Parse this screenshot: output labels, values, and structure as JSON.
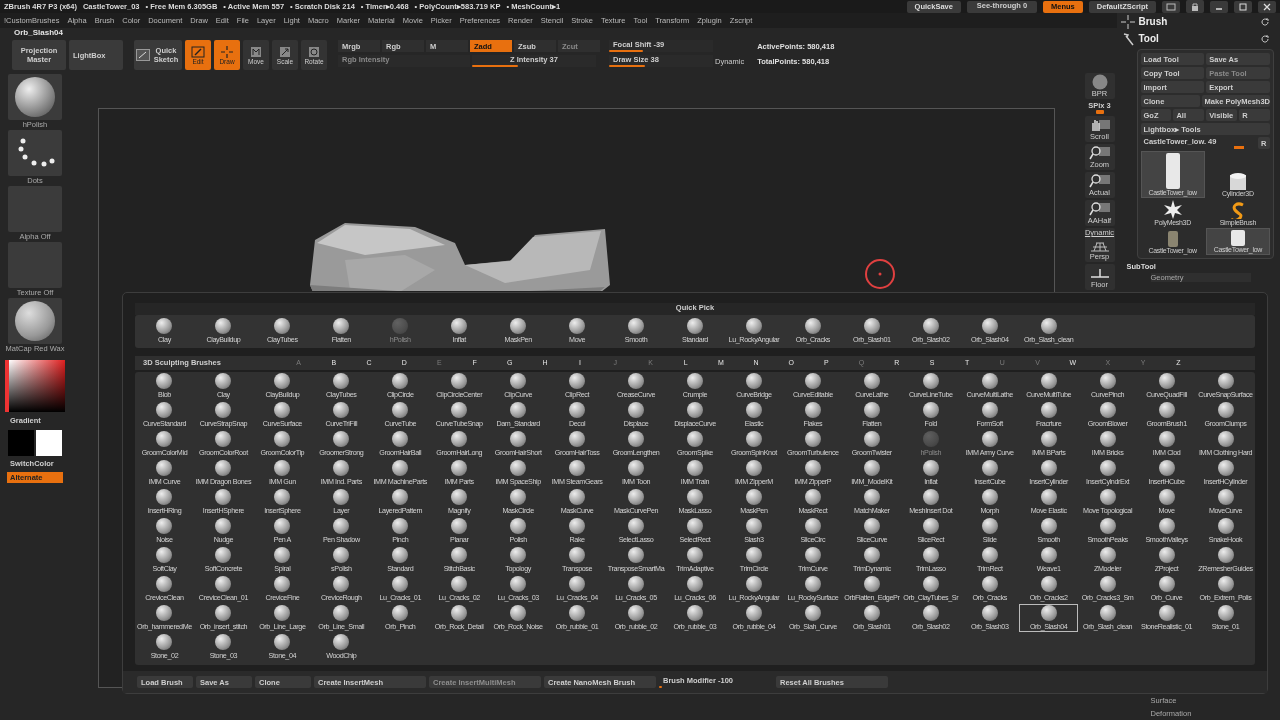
{
  "title_bar": {
    "app": "ZBrush 4R7 P3 (x64)",
    "document": "CastleTower_03",
    "stats": [
      "• Free Mem 6.305GB",
      "• Active Mem 557",
      "• Scratch Disk 214",
      "• Timer▸0.468",
      "• PolyCount▸583.719 KP",
      "• MeshCount▸1"
    ],
    "quicksave": "QuickSave",
    "see_through": {
      "label": "See-through",
      "value": "0",
      "level": 0
    },
    "menus": {
      "label": "Menus",
      "on": true
    },
    "script": "DefaultZScript"
  },
  "menu_bar": [
    "!CustomBrushes",
    "Alpha",
    "Brush",
    "Color",
    "Document",
    "Draw",
    "Edit",
    "File",
    "Layer",
    "Light",
    "Macro",
    "Marker",
    "Material",
    "Movie",
    "Picker",
    "Preferences",
    "Render",
    "Stencil",
    "Stroke",
    "Texture",
    "Tool",
    "Transform",
    "Zplugin",
    "Zscript"
  ],
  "current_brush": "Orb_Slash04",
  "toolbar": {
    "projection_master": "Projection Master",
    "lightbox": "LightBox",
    "quick_sketch": "Quick Sketch",
    "modes": [
      {
        "label": "Edit",
        "kind": "edit",
        "on": true
      },
      {
        "label": "Draw",
        "kind": "draw",
        "on": true
      },
      {
        "label": "Move",
        "kind": "move",
        "on": false
      },
      {
        "label": "Scale",
        "kind": "scale",
        "on": false
      },
      {
        "label": "Rotate",
        "kind": "rotate",
        "on": false
      }
    ],
    "color_modes": [
      {
        "label": "Mrgb",
        "on": false
      },
      {
        "label": "Rgb",
        "on": false
      },
      {
        "label": "M",
        "on": false
      }
    ],
    "rgb_intensity": {
      "label": "Rgb Intensity",
      "disabled": true
    },
    "z_modes": [
      {
        "label": "Zadd",
        "on": true,
        "disabled": false
      },
      {
        "label": "Zsub",
        "on": false,
        "disabled": false
      },
      {
        "label": "Zcut",
        "on": false,
        "disabled": true
      }
    ],
    "z_intensity": {
      "label": "Z Intensity",
      "value": "37",
      "level": 0.37
    },
    "focal_shift": {
      "label": "Focal Shift",
      "value": "-39",
      "level": 0.33
    },
    "draw_size": {
      "label": "Draw Size",
      "value": "38",
      "level": 0.35
    },
    "dynamic": "Dynamic",
    "active_points": "ActivePoints: 580,418",
    "total_points": "TotalPoints: 580,418"
  },
  "shelf": [
    {
      "label": "hPolish",
      "kind": "brush"
    },
    {
      "label": "Dots",
      "kind": "stroke"
    },
    {
      "label": "Alpha Off",
      "kind": "alpha"
    },
    {
      "label": "Texture Off",
      "kind": "texture"
    },
    {
      "label": "MatCap Red Wax",
      "kind": "material"
    }
  ],
  "gradient": "Gradient",
  "switch_color": "SwitchColor",
  "alternate": {
    "label": "Alternate",
    "on": true
  },
  "dock": [
    {
      "label": "BPR",
      "kind": "bpr"
    },
    {
      "label": "SPix 3",
      "kind": "slider",
      "level": 0.5
    },
    {
      "label": "Scroll",
      "kind": "scroll"
    },
    {
      "label": "Zoom",
      "kind": "zoom"
    },
    {
      "label": "Actual",
      "kind": "zoom"
    },
    {
      "label": "AAHalf",
      "kind": "zoom"
    },
    {
      "label": "Persp",
      "kind": "persp",
      "top": "Dynamic"
    },
    {
      "label": "Floor",
      "kind": "floor"
    }
  ],
  "right_panel": {
    "brush": "Brush",
    "tool": "Tool",
    "tool_buttons": [
      [
        {
          "label": "Load Tool",
          "disabled": false
        },
        {
          "label": "Save As",
          "disabled": false
        }
      ],
      [
        {
          "label": "Copy Tool",
          "disabled": false
        },
        {
          "label": "Paste Tool",
          "disabled": true
        }
      ],
      [
        {
          "label": "Import",
          "disabled": false
        },
        {
          "label": "Export",
          "disabled": false
        }
      ],
      [
        {
          "label": "Clone",
          "disabled": false
        },
        {
          "label": "Make PolyMesh3D",
          "disabled": false
        }
      ],
      [
        {
          "label": "GoZ",
          "disabled": false
        },
        {
          "label": "All",
          "disabled": false
        },
        {
          "label": "Visible",
          "disabled": false
        },
        {
          "label": "R",
          "disabled": false
        }
      ],
      [
        {
          "label": "Lightbox▸ Tools",
          "disabled": false
        }
      ]
    ],
    "tool_slider": {
      "label": "CastleTower_low. 49",
      "level": 0.9
    },
    "reset": "R",
    "tools": [
      {
        "label": "CastleTower_low",
        "kind": "tower",
        "selected": true
      },
      {
        "label": "Cylinder3D",
        "kind": "cylinder",
        "selected": false
      },
      {
        "label": "PolyMesh3D",
        "kind": "star",
        "selected": false
      },
      {
        "label": "SimpleBrush",
        "kind": "simple",
        "selected": false
      },
      {
        "label": "CastleTower_low",
        "kind": "tower-small",
        "selected": false
      },
      {
        "label": "CastleTower_low",
        "kind": "tower",
        "selected": true
      }
    ],
    "subtool": "SubTool",
    "geometry": "Geometry",
    "lower": [
      "Surface",
      "Deformation"
    ]
  },
  "brush_palette": {
    "quick_pick": {
      "title": "Quick Pick",
      "items": [
        {
          "name": "Clay",
          "disabled": false
        },
        {
          "name": "ClayBuildup",
          "disabled": false
        },
        {
          "name": "ClayTubes",
          "disabled": false
        },
        {
          "name": "Flatten",
          "disabled": false
        },
        {
          "name": "hPolish",
          "disabled": true
        },
        {
          "name": "Inflat",
          "disabled": false
        },
        {
          "name": "MaskPen",
          "disabled": false
        },
        {
          "name": "Move",
          "disabled": false
        },
        {
          "name": "Smooth",
          "disabled": false
        },
        {
          "name": "Standard",
          "disabled": false
        },
        {
          "name": "Lu_RockyAngular",
          "disabled": false
        },
        {
          "name": "Orb_Cracks",
          "disabled": false
        },
        {
          "name": "Orb_Slash01",
          "disabled": false
        },
        {
          "name": "Orb_Slash02",
          "disabled": false
        },
        {
          "name": "Orb_Slash04",
          "disabled": false
        },
        {
          "name": "Orb_Slash_clean",
          "disabled": false
        }
      ]
    },
    "title": "3D Sculpting Brushes",
    "letters": [
      {
        "letter": "A",
        "active": false
      },
      {
        "letter": "B",
        "active": true
      },
      {
        "letter": "C",
        "active": true
      },
      {
        "letter": "D",
        "active": true
      },
      {
        "letter": "E",
        "active": false
      },
      {
        "letter": "F",
        "active": true
      },
      {
        "letter": "G",
        "active": true
      },
      {
        "letter": "H",
        "active": true
      },
      {
        "letter": "I",
        "active": true
      },
      {
        "letter": "J",
        "active": false
      },
      {
        "letter": "K",
        "active": false
      },
      {
        "letter": "L",
        "active": true
      },
      {
        "letter": "M",
        "active": true
      },
      {
        "letter": "N",
        "active": true
      },
      {
        "letter": "O",
        "active": true
      },
      {
        "letter": "P",
        "active": true
      },
      {
        "letter": "Q",
        "active": false
      },
      {
        "letter": "R",
        "active": true
      },
      {
        "letter": "S",
        "active": true
      },
      {
        "letter": "T",
        "active": true
      },
      {
        "letter": "U",
        "active": false
      },
      {
        "letter": "V",
        "active": false
      },
      {
        "letter": "W",
        "active": true
      },
      {
        "letter": "X",
        "active": false
      },
      {
        "letter": "Y",
        "active": false
      },
      {
        "letter": "Z",
        "active": true
      }
    ],
    "items": [
      {
        "name": "Blob",
        "selected": false,
        "disabled": false
      },
      {
        "name": "Clay",
        "selected": false,
        "disabled": false
      },
      {
        "name": "ClayBuildup",
        "selected": false,
        "disabled": false
      },
      {
        "name": "ClayTubes",
        "selected": false,
        "disabled": false
      },
      {
        "name": "ClipCircle",
        "selected": false,
        "disabled": false
      },
      {
        "name": "ClipCircleCenter",
        "selected": false,
        "disabled": false
      },
      {
        "name": "ClipCurve",
        "selected": false,
        "disabled": false
      },
      {
        "name": "ClipRect",
        "selected": false,
        "disabled": false
      },
      {
        "name": "CreaseCurve",
        "selected": false,
        "disabled": false
      },
      {
        "name": "Crumple",
        "selected": false,
        "disabled": false
      },
      {
        "name": "CurveBridge",
        "selected": false,
        "disabled": false
      },
      {
        "name": "CurveEditable",
        "selected": false,
        "disabled": false
      },
      {
        "name": "CurveLathe",
        "selected": false,
        "disabled": false
      },
      {
        "name": "CurveLineTube",
        "selected": false,
        "disabled": false
      },
      {
        "name": "CurveMultiLathe",
        "selected": false,
        "disabled": false
      },
      {
        "name": "CurveMultiTube",
        "selected": false,
        "disabled": false
      },
      {
        "name": "CurvePinch",
        "selected": false,
        "disabled": false
      },
      {
        "name": "CurveQuadFill",
        "selected": false,
        "disabled": false
      },
      {
        "name": "CurveSnapSurface",
        "selected": false,
        "disabled": false
      },
      {
        "name": "CurveStandard",
        "selected": false,
        "disabled": false
      },
      {
        "name": "CurveStrapSnap",
        "selected": false,
        "disabled": false
      },
      {
        "name": "CurveSurface",
        "selected": false,
        "disabled": false
      },
      {
        "name": "CurveTriFill",
        "selected": false,
        "disabled": false
      },
      {
        "name": "CurveTube",
        "selected": false,
        "disabled": false
      },
      {
        "name": "CurveTubeSnap",
        "selected": false,
        "disabled": false
      },
      {
        "name": "Dam_Standard",
        "selected": false,
        "disabled": false
      },
      {
        "name": "Decol",
        "selected": false,
        "disabled": false
      },
      {
        "name": "Displace",
        "selected": false,
        "disabled": false
      },
      {
        "name": "DisplaceCurve",
        "selected": false,
        "disabled": false
      },
      {
        "name": "Elastic",
        "selected": false,
        "disabled": false
      },
      {
        "name": "Flakes",
        "selected": false,
        "disabled": false
      },
      {
        "name": "Flatten",
        "selected": false,
        "disabled": false
      },
      {
        "name": "Fold",
        "selected": false,
        "disabled": false
      },
      {
        "name": "FormSoft",
        "selected": false,
        "disabled": false
      },
      {
        "name": "Fracrture",
        "selected": false,
        "disabled": false
      },
      {
        "name": "GroomBlower",
        "selected": false,
        "disabled": false
      },
      {
        "name": "GroomBrush1",
        "selected": false,
        "disabled": false
      },
      {
        "name": "GroomClumps",
        "selected": false,
        "disabled": false
      },
      {
        "name": "GroomColorMid",
        "selected": false,
        "disabled": false
      },
      {
        "name": "GroomColorRoot",
        "selected": false,
        "disabled": false
      },
      {
        "name": "GroomColorTip",
        "selected": false,
        "disabled": false
      },
      {
        "name": "GroomerStrong",
        "selected": false,
        "disabled": false
      },
      {
        "name": "GroomHairBall",
        "selected": false,
        "disabled": false
      },
      {
        "name": "GroomHairLong",
        "selected": false,
        "disabled": false
      },
      {
        "name": "GroomHairShort",
        "selected": false,
        "disabled": false
      },
      {
        "name": "GroomHairToss",
        "selected": false,
        "disabled": false
      },
      {
        "name": "GroomLengthen",
        "selected": false,
        "disabled": false
      },
      {
        "name": "GroomSpike",
        "selected": false,
        "disabled": false
      },
      {
        "name": "GroomSpinKnot",
        "selected": false,
        "disabled": false
      },
      {
        "name": "GroomTurbulence",
        "selected": false,
        "disabled": false
      },
      {
        "name": "GroomTwister",
        "selected": false,
        "disabled": false
      },
      {
        "name": "hPolish",
        "selected": false,
        "disabled": true
      },
      {
        "name": "IMM Army Curve",
        "selected": false,
        "disabled": false
      },
      {
        "name": "IMM BParts",
        "selected": false,
        "disabled": false
      },
      {
        "name": "IMM Bricks",
        "selected": false,
        "disabled": false
      },
      {
        "name": "IMM Clod",
        "selected": false,
        "disabled": false
      },
      {
        "name": "IMM Clothing Hard",
        "selected": false,
        "disabled": false
      },
      {
        "name": "IMM Curve",
        "selected": false,
        "disabled": false
      },
      {
        "name": "IMM Dragon Bones",
        "selected": false,
        "disabled": false
      },
      {
        "name": "IMM Gun",
        "selected": false,
        "disabled": false
      },
      {
        "name": "IMM Ind. Parts",
        "selected": false,
        "disabled": false
      },
      {
        "name": "IMM MachineParts",
        "selected": false,
        "disabled": false
      },
      {
        "name": "IMM Parts",
        "selected": false,
        "disabled": false
      },
      {
        "name": "IMM SpaceShip",
        "selected": false,
        "disabled": false
      },
      {
        "name": "IMM SteamGears",
        "selected": false,
        "disabled": false
      },
      {
        "name": "IMM Toon",
        "selected": false,
        "disabled": false
      },
      {
        "name": "IMM Train",
        "selected": false,
        "disabled": false
      },
      {
        "name": "IMM ZipperM",
        "selected": false,
        "disabled": false
      },
      {
        "name": "IMM ZipperP",
        "selected": false,
        "disabled": false
      },
      {
        "name": "IMM_ModelKit",
        "selected": false,
        "disabled": false
      },
      {
        "name": "Inflat",
        "selected": false,
        "disabled": false
      },
      {
        "name": "InsertCube",
        "selected": false,
        "disabled": false
      },
      {
        "name": "InsertCylinder",
        "selected": false,
        "disabled": false
      },
      {
        "name": "InsertCylndrExt",
        "selected": false,
        "disabled": false
      },
      {
        "name": "InsertHCube",
        "selected": false,
        "disabled": false
      },
      {
        "name": "InsertHCylinder",
        "selected": false,
        "disabled": false
      },
      {
        "name": "InsertHRing",
        "selected": false,
        "disabled": false
      },
      {
        "name": "InsertHSphere",
        "selected": false,
        "disabled": false
      },
      {
        "name": "InsertSphere",
        "selected": false,
        "disabled": false
      },
      {
        "name": "Layer",
        "selected": false,
        "disabled": false
      },
      {
        "name": "LayeredPattern",
        "selected": false,
        "disabled": false
      },
      {
        "name": "Magnify",
        "selected": false,
        "disabled": false
      },
      {
        "name": "MaskCircle",
        "selected": false,
        "disabled": false
      },
      {
        "name": "MaskCurve",
        "selected": false,
        "disabled": false
      },
      {
        "name": "MaskCurvePen",
        "selected": false,
        "disabled": false
      },
      {
        "name": "MaskLasso",
        "selected": false,
        "disabled": false
      },
      {
        "name": "MaskPen",
        "selected": false,
        "disabled": false
      },
      {
        "name": "MaskRect",
        "selected": false,
        "disabled": false
      },
      {
        "name": "MatchMaker",
        "selected": false,
        "disabled": false
      },
      {
        "name": "MeshInsert Dot",
        "selected": false,
        "disabled": false
      },
      {
        "name": "Morph",
        "selected": false,
        "disabled": false
      },
      {
        "name": "Move Elastic",
        "selected": false,
        "disabled": false
      },
      {
        "name": "Move Topological",
        "selected": false,
        "disabled": false
      },
      {
        "name": "Move",
        "selected": false,
        "disabled": false
      },
      {
        "name": "MoveCurve",
        "selected": false,
        "disabled": false
      },
      {
        "name": "Noise",
        "selected": false,
        "disabled": false
      },
      {
        "name": "Nudge",
        "selected": false,
        "disabled": false
      },
      {
        "name": "Pen A",
        "selected": false,
        "disabled": false
      },
      {
        "name": "Pen Shadow",
        "selected": false,
        "disabled": false
      },
      {
        "name": "Pinch",
        "selected": false,
        "disabled": false
      },
      {
        "name": "Planar",
        "selected": false,
        "disabled": false
      },
      {
        "name": "Polish",
        "selected": false,
        "disabled": false
      },
      {
        "name": "Rake",
        "selected": false,
        "disabled": false
      },
      {
        "name": "SelectLasso",
        "selected": false,
        "disabled": false
      },
      {
        "name": "SelectRect",
        "selected": false,
        "disabled": false
      },
      {
        "name": "Slash3",
        "selected": false,
        "disabled": false
      },
      {
        "name": "SliceCirc",
        "selected": false,
        "disabled": false
      },
      {
        "name": "SliceCurve",
        "selected": false,
        "disabled": false
      },
      {
        "name": "SliceRect",
        "selected": false,
        "disabled": false
      },
      {
        "name": "Slide",
        "selected": false,
        "disabled": false
      },
      {
        "name": "Smooth",
        "selected": false,
        "disabled": false
      },
      {
        "name": "SmoothPeaks",
        "selected": false,
        "disabled": false
      },
      {
        "name": "SmoothValleys",
        "selected": false,
        "disabled": false
      },
      {
        "name": "SnakeHook",
        "selected": false,
        "disabled": false
      },
      {
        "name": "SoftClay",
        "selected": false,
        "disabled": false
      },
      {
        "name": "SoftConcrete",
        "selected": false,
        "disabled": false
      },
      {
        "name": "Spiral",
        "selected": false,
        "disabled": false
      },
      {
        "name": "sPolish",
        "selected": false,
        "disabled": false
      },
      {
        "name": "Standard",
        "selected": false,
        "disabled": false
      },
      {
        "name": "StitchBasic",
        "selected": false,
        "disabled": false
      },
      {
        "name": "Topology",
        "selected": false,
        "disabled": false
      },
      {
        "name": "Transpose",
        "selected": false,
        "disabled": false
      },
      {
        "name": "TransposeSmartMa",
        "selected": false,
        "disabled": false
      },
      {
        "name": "TrimAdaptive",
        "selected": false,
        "disabled": false
      },
      {
        "name": "TrimCircle",
        "selected": false,
        "disabled": false
      },
      {
        "name": "TrimCurve",
        "selected": false,
        "disabled": false
      },
      {
        "name": "TrimDynamic",
        "selected": false,
        "disabled": false
      },
      {
        "name": "TrimLasso",
        "selected": false,
        "disabled": false
      },
      {
        "name": "TrimRect",
        "selected": false,
        "disabled": false
      },
      {
        "name": "Weave1",
        "selected": false,
        "disabled": false
      },
      {
        "name": "ZModeler",
        "selected": false,
        "disabled": false
      },
      {
        "name": "ZProject",
        "selected": false,
        "disabled": false
      },
      {
        "name": "ZRemesherGuides",
        "selected": false,
        "disabled": false
      },
      {
        "name": "CreviceClean",
        "selected": false,
        "disabled": false
      },
      {
        "name": "CreviceClean_01",
        "selected": false,
        "disabled": false
      },
      {
        "name": "CreviceFine",
        "selected": false,
        "disabled": false
      },
      {
        "name": "CreviceRough",
        "selected": false,
        "disabled": false
      },
      {
        "name": "Lu_Cracks_01",
        "selected": false,
        "disabled": false
      },
      {
        "name": "Lu_Cracks_02",
        "selected": false,
        "disabled": false
      },
      {
        "name": "Lu_Cracks_03",
        "selected": false,
        "disabled": false
      },
      {
        "name": "Lu_Cracks_04",
        "selected": false,
        "disabled": false
      },
      {
        "name": "Lu_Cracks_05",
        "selected": false,
        "disabled": false
      },
      {
        "name": "Lu_Cracks_06",
        "selected": false,
        "disabled": false
      },
      {
        "name": "Lu_RockyAngular",
        "selected": false,
        "disabled": false
      },
      {
        "name": "Lu_RockySurface",
        "selected": false,
        "disabled": false
      },
      {
        "name": "OrbFlatten_EdgePr",
        "selected": false,
        "disabled": false
      },
      {
        "name": "Orb_ClayTubes_Sr",
        "selected": false,
        "disabled": false
      },
      {
        "name": "Orb_Cracks",
        "selected": false,
        "disabled": false
      },
      {
        "name": "Orb_Cracks2",
        "selected": false,
        "disabled": false
      },
      {
        "name": "Orb_Cracks3_Sm",
        "selected": false,
        "disabled": false
      },
      {
        "name": "Orb_Curve",
        "selected": false,
        "disabled": false
      },
      {
        "name": "Orb_Extrem_Polis",
        "selected": false,
        "disabled": false
      },
      {
        "name": "Orb_hammeredMe",
        "selected": false,
        "disabled": false
      },
      {
        "name": "Orb_insert_stitch",
        "selected": false,
        "disabled": false
      },
      {
        "name": "Orb_Line_Large",
        "selected": false,
        "disabled": false
      },
      {
        "name": "Orb_Line_Small",
        "selected": false,
        "disabled": false
      },
      {
        "name": "Orb_Pinch",
        "selected": false,
        "disabled": false
      },
      {
        "name": "Orb_Rock_Detail",
        "selected": false,
        "disabled": false
      },
      {
        "name": "Orb_Rock_Noise",
        "selected": false,
        "disabled": false
      },
      {
        "name": "Orb_rubble_01",
        "selected": false,
        "disabled": false
      },
      {
        "name": "Orb_rubble_02",
        "selected": false,
        "disabled": false
      },
      {
        "name": "Orb_rubble_03",
        "selected": false,
        "disabled": false
      },
      {
        "name": "Orb_rubble_04",
        "selected": false,
        "disabled": false
      },
      {
        "name": "Orb_Slah_Curve",
        "selected": false,
        "disabled": false
      },
      {
        "name": "Orb_Slash01",
        "selected": false,
        "disabled": false
      },
      {
        "name": "Orb_Slash02",
        "selected": false,
        "disabled": false
      },
      {
        "name": "Orb_Slash03",
        "selected": false,
        "disabled": false
      },
      {
        "name": "Orb_Slash04",
        "selected": true,
        "disabled": false
      },
      {
        "name": "Orb_Slash_clean",
        "selected": false,
        "disabled": false
      },
      {
        "name": "StoneRealistic_01",
        "selected": false,
        "disabled": false
      },
      {
        "name": "Stone_01",
        "selected": false,
        "disabled": false
      },
      {
        "name": "Stone_02",
        "selected": false,
        "disabled": false
      },
      {
        "name": "Stone_03",
        "selected": false,
        "disabled": false
      },
      {
        "name": "Stone_04",
        "selected": false,
        "disabled": false
      },
      {
        "name": "WoodChip",
        "selected": false,
        "disabled": false
      }
    ],
    "buttons": [
      {
        "label": "Load Brush",
        "disabled": false
      },
      {
        "label": "Save As",
        "disabled": false
      },
      {
        "label": "Clone",
        "disabled": false
      },
      {
        "label": "Create InsertMesh",
        "disabled": false
      },
      {
        "label": "Create InsertMultiMesh",
        "disabled": true
      },
      {
        "label": "Create NanoMesh Brush",
        "disabled": false
      }
    ],
    "modifier": {
      "label": "Brush Modifier",
      "value": "-100",
      "level": 0.03
    },
    "reset": "Reset All Brushes"
  }
}
